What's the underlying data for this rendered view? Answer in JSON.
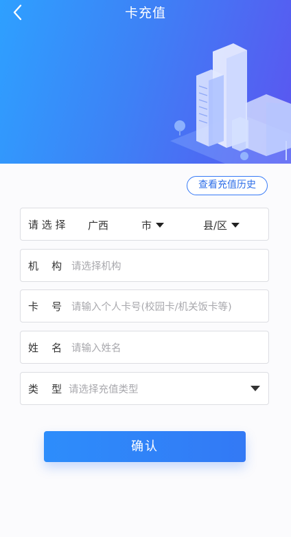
{
  "nav": {
    "title": "卡充值",
    "back_icon": "chevron-left-icon"
  },
  "history_button": "查看充值历史",
  "region": {
    "label": "请 选 择",
    "province": "广西",
    "city": "市",
    "county": "县/区"
  },
  "institution": {
    "label": "机    构",
    "placeholder": "请选择机构"
  },
  "card_number": {
    "label": "卡    号",
    "placeholder": "请输入个人卡号(校园卡/机关饭卡等)"
  },
  "name": {
    "label": "姓    名",
    "placeholder": "请输入姓名"
  },
  "type": {
    "label": "类    型",
    "placeholder": "请选择充值类型"
  },
  "confirm_button": "确认",
  "colors": {
    "brand_blue": "#3478f6",
    "header_gradient_start": "#2ea0ff",
    "header_gradient_end": "#5b55f0"
  }
}
